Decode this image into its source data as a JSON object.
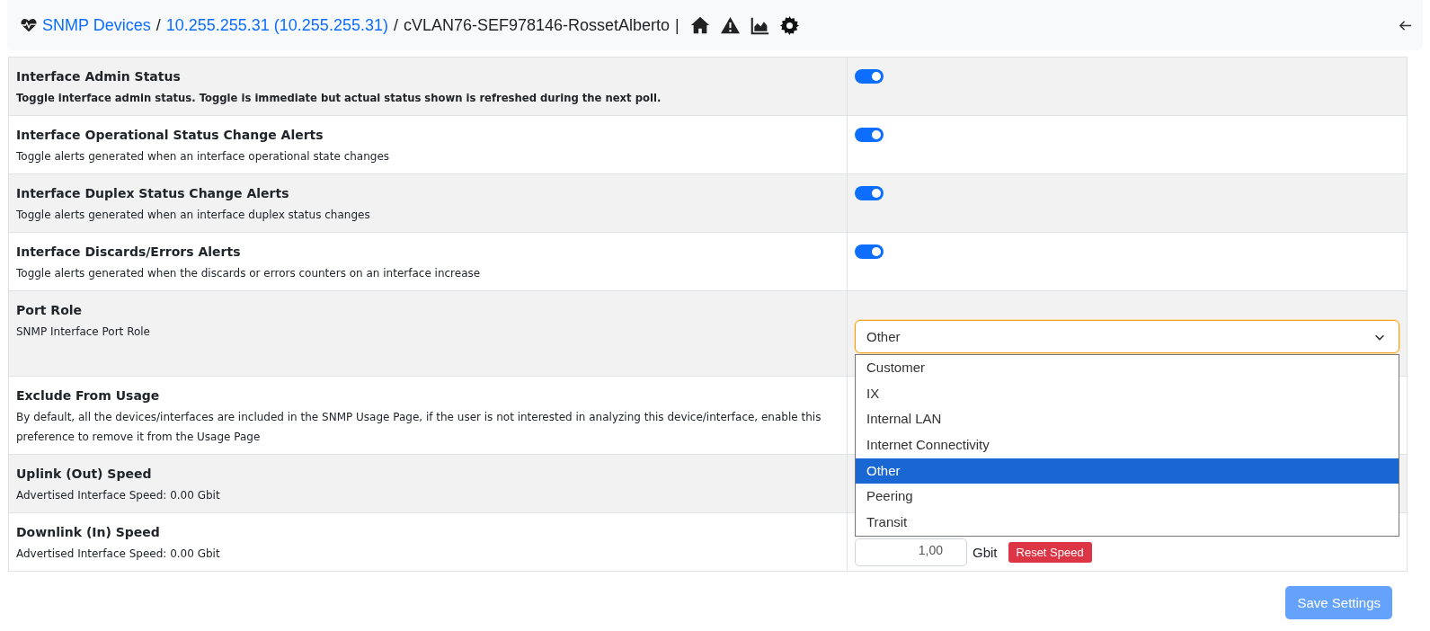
{
  "breadcrumb": {
    "links": [
      "SNMP Devices",
      "10.255.255.31 (10.255.255.31)"
    ],
    "current": "cVLAN76-SEF978146-RossetAlberto",
    "separator": "/",
    "divider": "|"
  },
  "settings": [
    {
      "title": "Interface Admin Status",
      "description": "Toggle interface admin status. Toggle is immediate but actual status shown is refreshed during the next poll.",
      "description_bold": true,
      "kind": "toggle",
      "on": true
    },
    {
      "title": "Interface Operational Status Change Alerts",
      "description": "Toggle alerts generated when an interface operational state changes",
      "description_bold": false,
      "kind": "toggle",
      "on": true
    },
    {
      "title": "Interface Duplex Status Change Alerts",
      "description": "Toggle alerts generated when an interface duplex status changes",
      "description_bold": false,
      "kind": "toggle",
      "on": true
    },
    {
      "title": "Interface Discards/Errors Alerts",
      "description": "Toggle alerts generated when the discards or errors counters on an interface increase",
      "description_bold": false,
      "kind": "toggle",
      "on": true
    },
    {
      "title": "Port Role",
      "description": "SNMP Interface Port Role",
      "description_bold": false,
      "kind": "select",
      "value": "Other",
      "expanded": true,
      "options": [
        {
          "label": "Customer",
          "selected": false
        },
        {
          "label": "IX",
          "selected": false
        },
        {
          "label": "Internal LAN",
          "selected": false
        },
        {
          "label": "Internet Connectivity",
          "selected": false
        },
        {
          "label": "Other",
          "selected": true
        },
        {
          "label": "Peering",
          "selected": false
        },
        {
          "label": "Transit",
          "selected": false
        }
      ]
    },
    {
      "title": "Exclude From Usage",
      "description": "By default, all the devices/interfaces are included in the SNMP Usage Page, if the user is not interested in analyzing this device/interface, enable this preference to remove it from the Usage Page",
      "description_bold": false,
      "kind": "hidden"
    },
    {
      "title": "Uplink (Out) Speed",
      "description": "Advertised Interface Speed: 0.00 Gbit",
      "description_bold": false,
      "kind": "hidden"
    },
    {
      "title": "Downlink (In) Speed",
      "description": "Advertised Interface Speed: 0.00 Gbit",
      "description_bold": false,
      "kind": "speed",
      "value": "1,00",
      "unit": "Gbit",
      "button": "Reset Speed"
    }
  ],
  "save_button": "Save Settings"
}
